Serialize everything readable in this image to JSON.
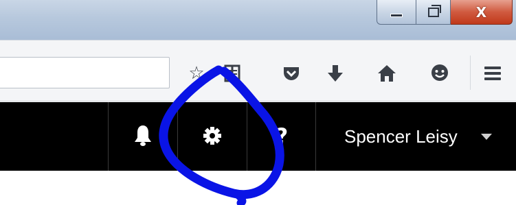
{
  "window": {
    "controls": {
      "minimize_icon": "minimize-icon",
      "maximize_icon": "restore-icon",
      "close_label": "X"
    }
  },
  "browser_toolbar": {
    "url_value": "",
    "icons": [
      "bookmark-star-icon",
      "reading-list-icon",
      "pocket-icon",
      "downloads-icon",
      "home-icon",
      "hello-chat-icon",
      "menu-icon"
    ]
  },
  "navbar": {
    "background": "#000000",
    "notifications_icon": "bell-icon",
    "settings_icon": "gear-icon",
    "help_label": "?",
    "user_name": "Spencer Leisy",
    "user_menu_icon": "caret-down-icon"
  },
  "annotation": {
    "shape": "hand-drawn circle around settings gear",
    "color": "#0a14e6"
  }
}
